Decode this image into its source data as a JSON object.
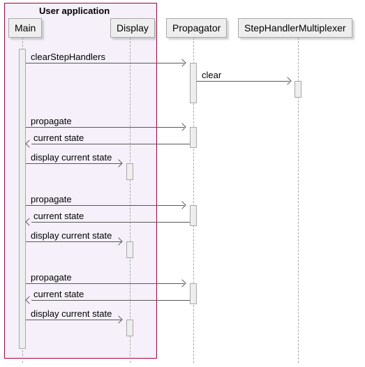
{
  "frame": {
    "label": "User application"
  },
  "participants": {
    "main": "Main",
    "display": "Display",
    "propagator": "Propagator",
    "multiplexer": "StepHandlerMultiplexer"
  },
  "messages": {
    "clearStepHandlers": "clearStepHandlers",
    "clear": "clear",
    "propagate": "propagate",
    "currentState": "current state",
    "displayCurrentState": "display current state"
  },
  "chart_data": {
    "type": "sequence-diagram",
    "frame": {
      "name": "User application",
      "participants": [
        "Main",
        "Display"
      ]
    },
    "participants": [
      "Main",
      "Display",
      "Propagator",
      "StepHandlerMultiplexer"
    ],
    "interactions": [
      {
        "from": "Main",
        "to": "Propagator",
        "label": "clearStepHandlers",
        "kind": "call"
      },
      {
        "from": "Propagator",
        "to": "StepHandlerMultiplexer",
        "label": "clear",
        "kind": "call"
      },
      {
        "from": "Main",
        "to": "Propagator",
        "label": "propagate",
        "kind": "call"
      },
      {
        "from": "Propagator",
        "to": "Main",
        "label": "current state",
        "kind": "return"
      },
      {
        "from": "Main",
        "to": "Display",
        "label": "display current state",
        "kind": "call"
      },
      {
        "from": "Main",
        "to": "Propagator",
        "label": "propagate",
        "kind": "call"
      },
      {
        "from": "Propagator",
        "to": "Main",
        "label": "current state",
        "kind": "return"
      },
      {
        "from": "Main",
        "to": "Display",
        "label": "display current state",
        "kind": "call"
      },
      {
        "from": "Main",
        "to": "Propagator",
        "label": "propagate",
        "kind": "call"
      },
      {
        "from": "Propagator",
        "to": "Main",
        "label": "current state",
        "kind": "return"
      },
      {
        "from": "Main",
        "to": "Display",
        "label": "display current state",
        "kind": "call"
      }
    ]
  }
}
